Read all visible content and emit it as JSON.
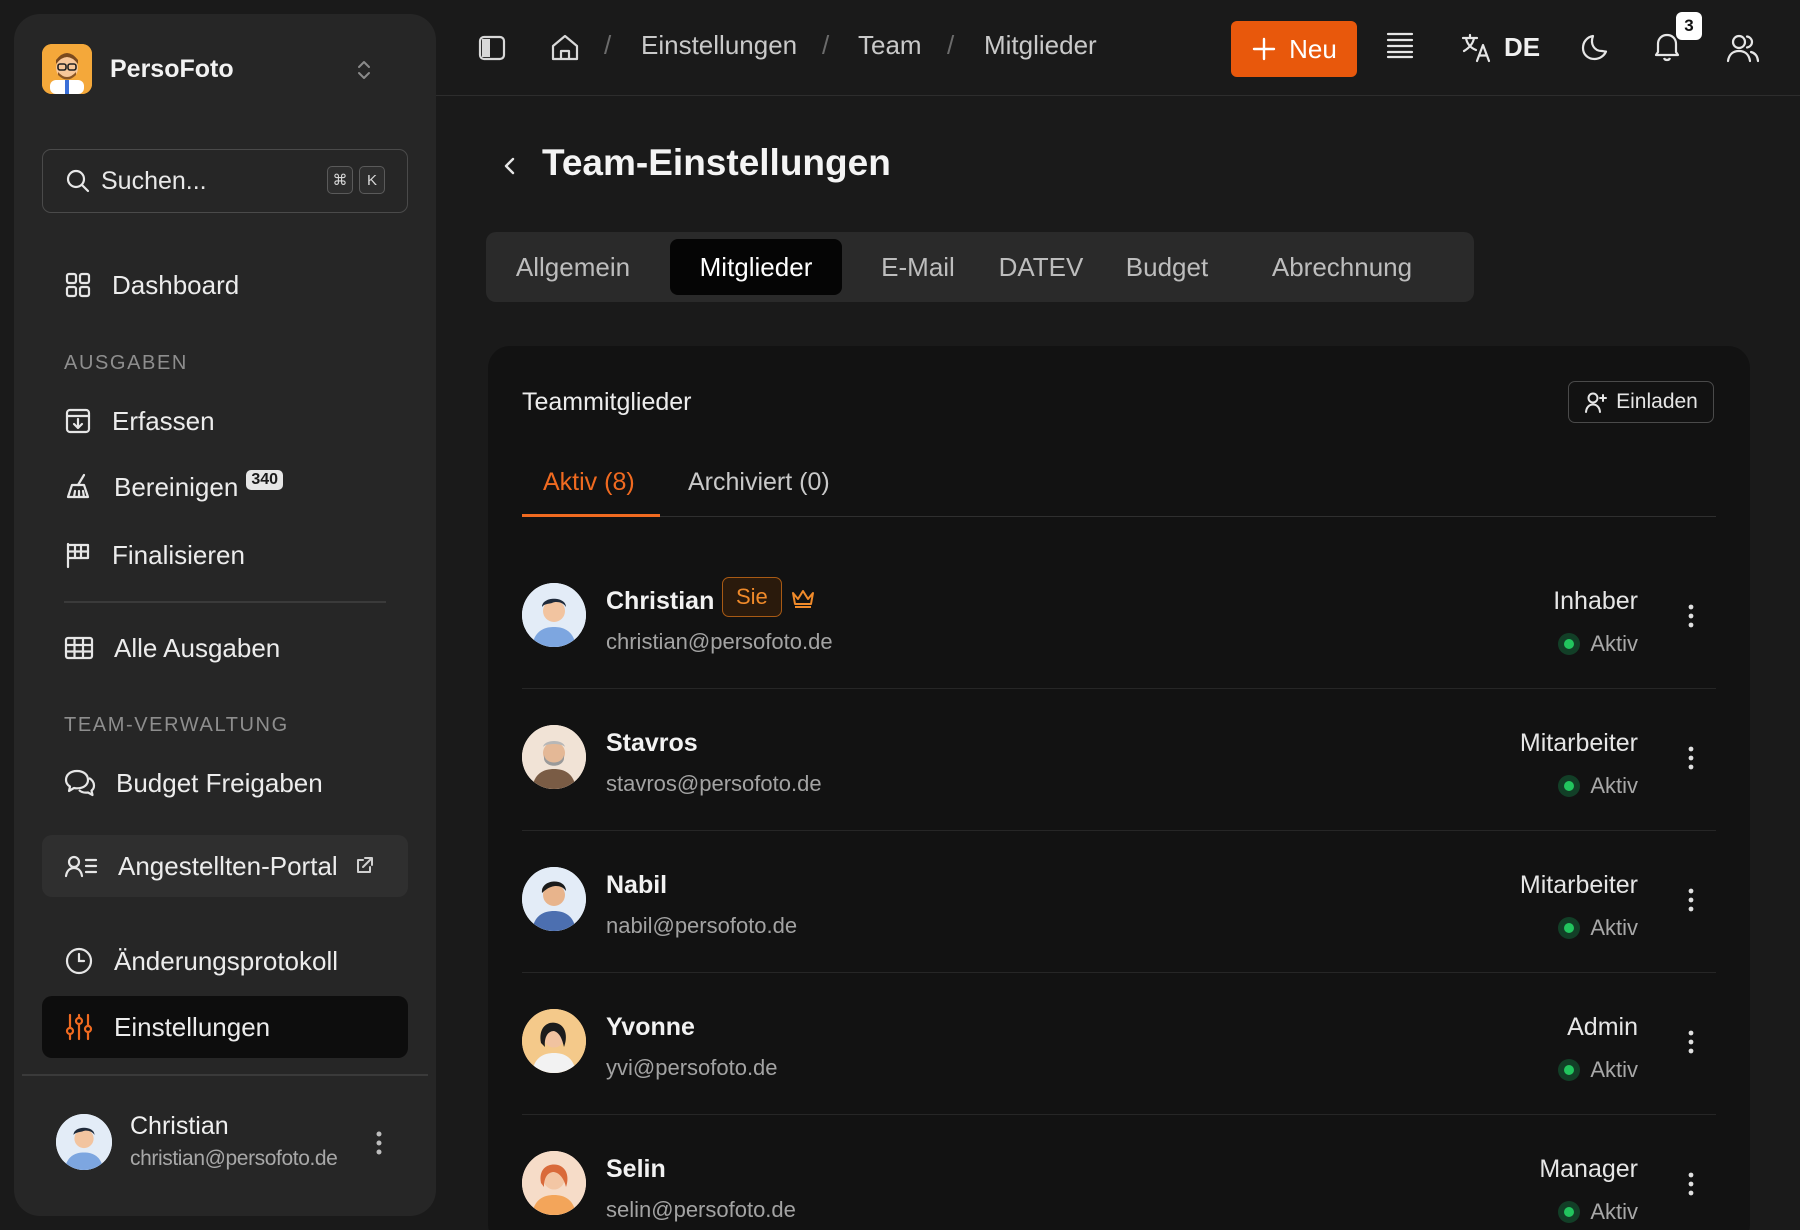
{
  "brand": {
    "name": "PersoFoto"
  },
  "search": {
    "placeholder": "Suchen...",
    "kbd1": "⌘",
    "kbd2": "K"
  },
  "sidebar": {
    "dashboard": "Dashboard",
    "section_ausgaben": "AUSGABEN",
    "erfassen": "Erfassen",
    "bereinigen": "Bereinigen",
    "bereinigen_count": "340",
    "finalisieren": "Finalisieren",
    "alle_ausgaben": "Alle Ausgaben",
    "section_team": "TEAM-VERWALTUNG",
    "budget_freigaben": "Budget Freigaben",
    "angestellten_portal": "Angestellten-Portal",
    "aenderungsprotokoll": "Änderungsprotokoll",
    "einstellungen": "Einstellungen"
  },
  "current_user": {
    "name": "Christian",
    "email": "christian@persofoto.de"
  },
  "topbar": {
    "breadcrumb": [
      "Einstellungen",
      "Team",
      "Mitglieder"
    ],
    "new_label": "Neu",
    "language": "DE",
    "notifications": "3"
  },
  "page": {
    "title": "Team-Einstellungen"
  },
  "tabs": [
    "Allgemein",
    "Mitglieder",
    "E-Mail",
    "DATEV",
    "Budget",
    "Abrechnung"
  ],
  "active_tab": "Mitglieder",
  "members_card": {
    "title": "Teammitglieder",
    "invite_label": "Einladen",
    "subtab_active": "Aktiv (8)",
    "subtab_archived": "Archiviert (0)"
  },
  "members": [
    {
      "name": "Christian",
      "email": "christian@persofoto.de",
      "role": "Inhaber",
      "status": "Aktiv",
      "you_badge": "Sie",
      "owner": true
    },
    {
      "name": "Stavros",
      "email": "stavros@persofoto.de",
      "role": "Mitarbeiter",
      "status": "Aktiv"
    },
    {
      "name": "Nabil",
      "email": "nabil@persofoto.de",
      "role": "Mitarbeiter",
      "status": "Aktiv"
    },
    {
      "name": "Yvonne",
      "email": "yvi@persofoto.de",
      "role": "Admin",
      "status": "Aktiv"
    },
    {
      "name": "Selin",
      "email": "selin@persofoto.de",
      "role": "Manager",
      "status": "Aktiv"
    }
  ],
  "colors": {
    "accent": "#e8580c",
    "active_status": "#22c55e",
    "background": "#1a1a1a"
  }
}
